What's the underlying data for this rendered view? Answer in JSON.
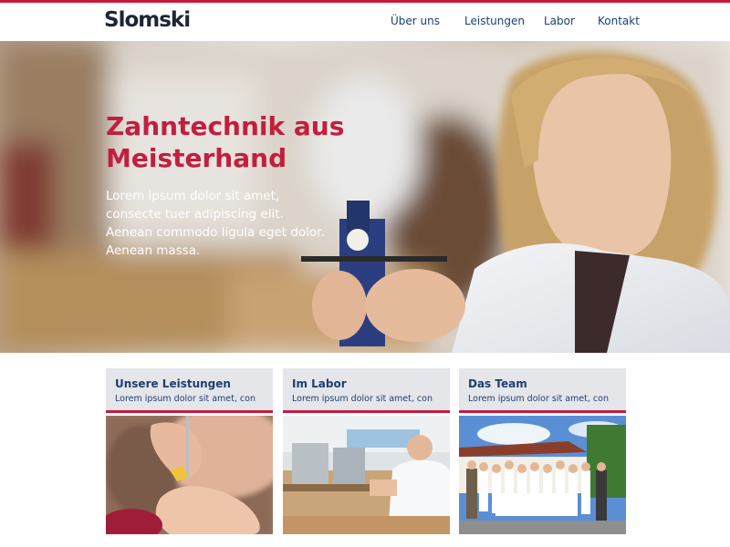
{
  "header": {
    "logo": "Slomski",
    "nav": [
      "Über uns",
      "Leistungen",
      "Labor",
      "Kontakt"
    ]
  },
  "hero": {
    "title_line1": "Zahntechnik aus",
    "title_line2": "Meisterhand",
    "text": "Lorem ipsum dolor sit amet, consecte tuer adipiscing elit. Aenean commodo ligula eget dolor. Aenean massa."
  },
  "cards": [
    {
      "title": "Unsere Leistungen",
      "subtitle": "Lorem ipsum dolor sit amet, con"
    },
    {
      "title": "Im Labor",
      "subtitle": "Lorem ipsum dolor sit amet, con"
    },
    {
      "title": "Das Team",
      "subtitle": "Lorem ipsum dolor sit amet, con"
    }
  ],
  "colors": {
    "accent": "#c8193c",
    "heading_red": "#c11f3e",
    "nav_blue": "#1d3f70",
    "card_bg": "#e4e6ea",
    "logo": "#1c2536"
  }
}
